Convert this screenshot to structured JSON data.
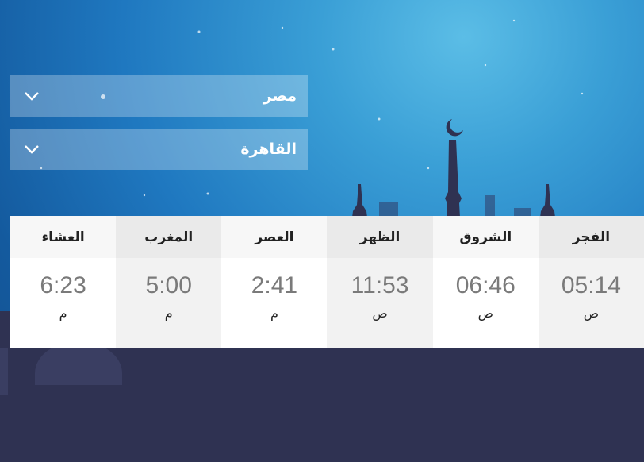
{
  "colors": {
    "sky_top": "#5bbde6",
    "sky_bottom": "#124f8e",
    "silhouette": "#2f3252",
    "header_shade": "#eaeaea",
    "time_text": "#7a7a7a"
  },
  "selectors": {
    "country": {
      "value": "مصر",
      "icon": "chevron-down-icon"
    },
    "city": {
      "value": "القاهرة",
      "icon": "chevron-down-icon"
    }
  },
  "prayers": [
    {
      "name": "الفجر",
      "time": "05:14",
      "period": "ص"
    },
    {
      "name": "الشروق",
      "time": "06:46",
      "period": "ص"
    },
    {
      "name": "الظهر",
      "time": "11:53",
      "period": "ص"
    },
    {
      "name": "العصر",
      "time": "2:41",
      "period": "م"
    },
    {
      "name": "المغرب",
      "time": "5:00",
      "period": "م"
    },
    {
      "name": "العشاء",
      "time": "6:23",
      "period": "م"
    }
  ]
}
